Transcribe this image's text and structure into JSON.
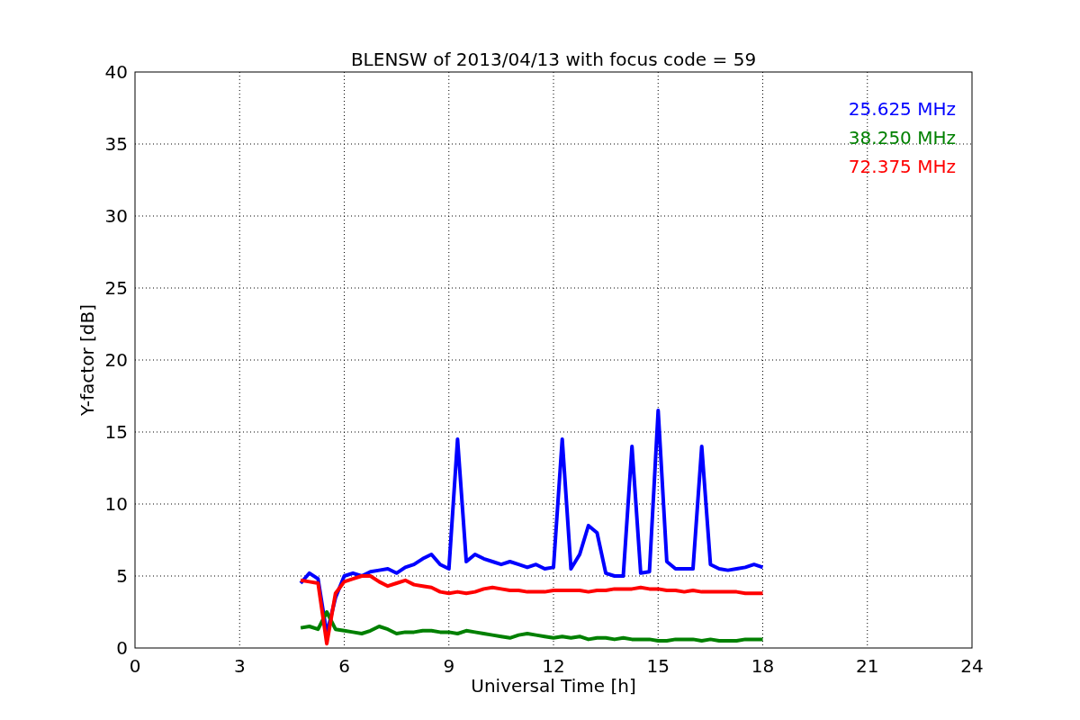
{
  "chart_data": {
    "type": "line",
    "title": "BLENSW of 2013/04/13 with focus code = 59",
    "xlabel": "Universal Time [h]",
    "ylabel": "Y-factor [dB]",
    "x": [
      4.75,
      5,
      5.25,
      5.5,
      5.75,
      6,
      6.25,
      6.5,
      6.75,
      7,
      7.25,
      7.5,
      7.75,
      8,
      8.25,
      8.5,
      8.75,
      9,
      9.25,
      9.5,
      9.75,
      10,
      10.25,
      10.5,
      10.75,
      11,
      11.25,
      11.5,
      11.75,
      12,
      12.25,
      12.5,
      12.75,
      13,
      13.25,
      13.5,
      13.75,
      14,
      14.25,
      14.5,
      14.75,
      15,
      15.25,
      15.5,
      15.75,
      16,
      16.25,
      16.5,
      16.75,
      17,
      17.25,
      17.5,
      17.75,
      18
    ],
    "series": [
      {
        "name": "25.625 MHz",
        "color": "#0000ff",
        "values": [
          4.5,
          5.2,
          4.8,
          1.0,
          3.5,
          5.0,
          5.2,
          5.0,
          5.3,
          5.4,
          5.5,
          5.2,
          5.6,
          5.8,
          6.2,
          6.5,
          5.8,
          5.5,
          14.5,
          6.0,
          6.5,
          6.2,
          6.0,
          5.8,
          6.0,
          5.8,
          5.6,
          5.8,
          5.5,
          5.6,
          14.5,
          5.5,
          6.5,
          8.5,
          8.0,
          5.2,
          5.0,
          5.0,
          14.0,
          5.2,
          5.3,
          16.5,
          6.0,
          5.5,
          5.5,
          5.5,
          14.0,
          5.8,
          5.5,
          5.4,
          5.5,
          5.6,
          5.8,
          5.6
        ]
      },
      {
        "name": "38.250 MHz",
        "color": "#008000",
        "values": [
          1.4,
          1.5,
          1.3,
          2.5,
          1.3,
          1.2,
          1.1,
          1.0,
          1.2,
          1.5,
          1.3,
          1.0,
          1.1,
          1.1,
          1.2,
          1.2,
          1.1,
          1.1,
          1.0,
          1.2,
          1.1,
          1.0,
          0.9,
          0.8,
          0.7,
          0.9,
          1.0,
          0.9,
          0.8,
          0.7,
          0.8,
          0.7,
          0.8,
          0.6,
          0.7,
          0.7,
          0.6,
          0.7,
          0.6,
          0.6,
          0.6,
          0.5,
          0.5,
          0.6,
          0.6,
          0.6,
          0.5,
          0.6,
          0.5,
          0.5,
          0.5,
          0.6,
          0.6,
          0.6
        ]
      },
      {
        "name": "72.375 MHz",
        "color": "#ff0000",
        "values": [
          4.7,
          4.6,
          4.5,
          0.3,
          3.8,
          4.6,
          4.8,
          5.0,
          5.0,
          4.6,
          4.3,
          4.5,
          4.7,
          4.4,
          4.3,
          4.2,
          3.9,
          3.8,
          3.9,
          3.8,
          3.9,
          4.1,
          4.2,
          4.1,
          4.0,
          4.0,
          3.9,
          3.9,
          3.9,
          4.0,
          4.0,
          4.0,
          4.0,
          3.9,
          4.0,
          4.0,
          4.1,
          4.1,
          4.1,
          4.2,
          4.1,
          4.1,
          4.0,
          4.0,
          3.9,
          4.0,
          3.9,
          3.9,
          3.9,
          3.9,
          3.9,
          3.8,
          3.8,
          3.8
        ]
      }
    ],
    "grid": true,
    "xlim": [
      0,
      24
    ],
    "ylim": [
      0,
      40
    ],
    "xticks": [
      0,
      3,
      6,
      9,
      12,
      15,
      18,
      21,
      24
    ],
    "yticks": [
      0,
      5,
      10,
      15,
      20,
      25,
      30,
      35,
      40
    ]
  }
}
